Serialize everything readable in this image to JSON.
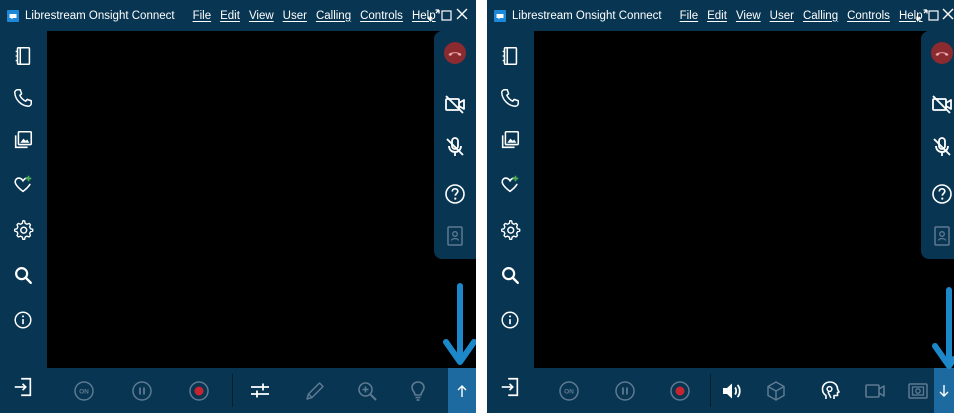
{
  "app": {
    "title": "Librestream Onsight Connect",
    "menu": [
      "File",
      "Edit",
      "View",
      "User",
      "Calling",
      "Controls",
      "Help"
    ]
  },
  "colors": {
    "chrome": "#073552",
    "video_background": "#000000",
    "highlight": "#1c6a9f",
    "annotation_arrow": "#1c87c9",
    "hangup_red": "#8b2b2f",
    "record_red": "#c8242f",
    "green_accent": "#4caf50"
  },
  "left_window": {
    "sidebar_icons": [
      "book-icon",
      "phone-icon",
      "gallery-icon",
      "favorites-icon",
      "gear-icon",
      "search-icon",
      "info-icon",
      "sign-in-icon"
    ],
    "bottom_toolbar": [
      "on-button",
      "pause-button",
      "record-button",
      "adjust-sliders-icon",
      "pen-icon",
      "zoom-in-icon",
      "lightbulb-icon",
      "expand-up-arrow-button"
    ],
    "side_panel": [
      "hang-up-button",
      "camera-off-icon",
      "mic-off-icon",
      "help-icon",
      "contact-card-icon"
    ],
    "on_label": "ON"
  },
  "right_window": {
    "sidebar_icons": [
      "book-icon",
      "phone-icon",
      "gallery-icon",
      "favorites-icon",
      "gear-icon",
      "search-icon",
      "info-icon",
      "sign-in-icon"
    ],
    "bottom_toolbar": [
      "on-button",
      "pause-button",
      "record-button",
      "speaker-icon",
      "cube-icon",
      "face-pointer-icon",
      "video-camera-icon",
      "snapshot-icon",
      "collapse-down-arrow-button"
    ],
    "side_panel": [
      "hang-up-button",
      "camera-off-icon",
      "mic-off-icon",
      "help-icon",
      "contact-card-icon"
    ],
    "on_label": "ON"
  }
}
